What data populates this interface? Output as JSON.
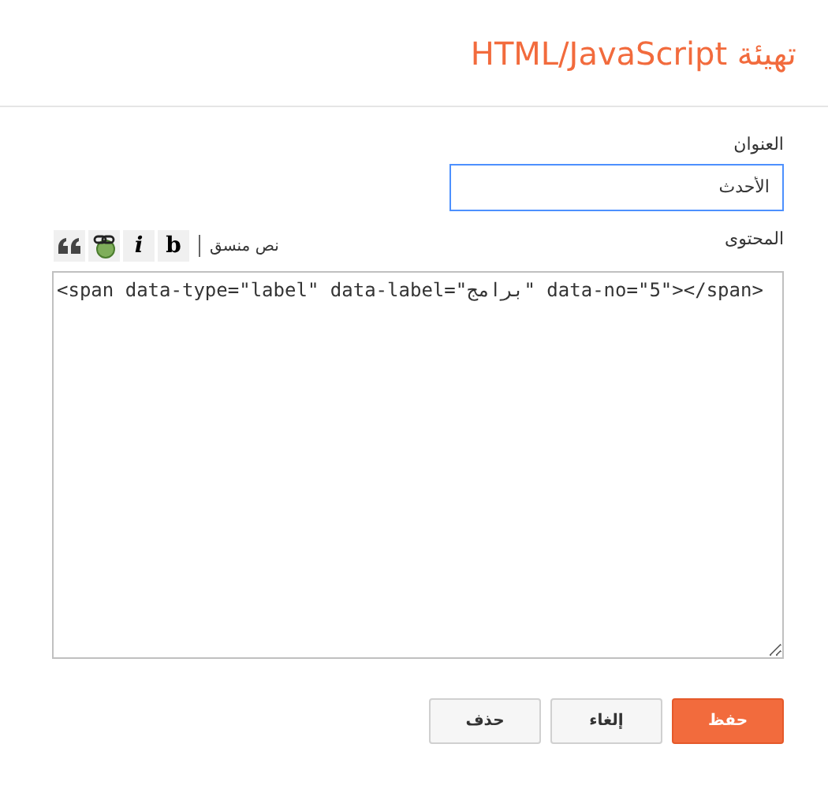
{
  "dialog": {
    "title": "تهيئة HTML/JavaScript"
  },
  "title_field": {
    "label": "العنوان",
    "value": "الأحدث"
  },
  "toolbar": {
    "buttons": [
      {
        "kind": "bold",
        "label": "b"
      },
      {
        "kind": "italic",
        "label": "i"
      },
      {
        "kind": "link"
      },
      {
        "kind": "quote"
      }
    ],
    "rich_text_link": "نص منسق"
  },
  "content_field": {
    "label": "المحتوى",
    "value": "<span data-type=\"label\" data-label=\"برامج\" data-no=\"5\"></span>"
  },
  "buttons": [
    {
      "label": "حفظ",
      "kind": "primary"
    },
    {
      "label": "إلغاء",
      "kind": "secondary"
    },
    {
      "label": "حذف",
      "kind": "secondary"
    }
  ]
}
